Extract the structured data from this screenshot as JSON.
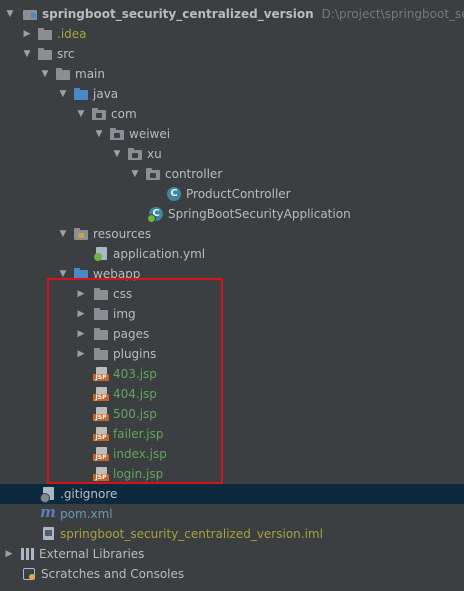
{
  "project": {
    "name": "springboot_security_centralized_version",
    "path": "D:\\project\\springboot_secu"
  },
  "tree": {
    "idea": ".idea",
    "src": "src",
    "main": "main",
    "java": "java",
    "com": "com",
    "weiwei": "weiwei",
    "xu": "xu",
    "controller": "controller",
    "product_controller": "ProductController",
    "app_class": "SpringBootSecurityApplication",
    "resources": "resources",
    "application_yml": "application.yml",
    "webapp": "webapp",
    "css": "css",
    "img": "img",
    "pages": "pages",
    "plugins": "plugins",
    "jsp_403": "403.jsp",
    "jsp_404": "404.jsp",
    "jsp_500": "500.jsp",
    "jsp_failer": "failer.jsp",
    "jsp_index": "index.jsp",
    "jsp_login": "login.jsp",
    "gitignore": ".gitignore",
    "pom": "pom.xml",
    "iml": "springboot_security_centralized_version.iml",
    "external_libraries": "External Libraries",
    "scratches": "Scratches and Consoles"
  },
  "icons": {
    "expanded": "▼",
    "collapsed": "▶",
    "jsp_tag": "JSP"
  },
  "colors": {
    "background": "#3c3f41",
    "selection": "#0d293e",
    "highlight_border": "#d8121a",
    "jsp_text": "#62a55b",
    "ignored_text": "#a7a23e"
  }
}
